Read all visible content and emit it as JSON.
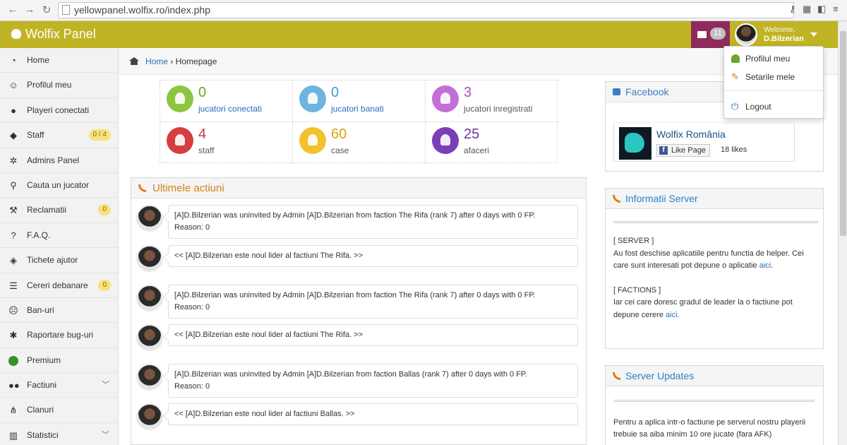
{
  "browser": {
    "url": "yellowpanel.wolfix.ro/index.php"
  },
  "header": {
    "brand": "Wolfix Panel",
    "messages_count": "11",
    "welcome": "Welcome,",
    "username": "D.Bilzerian"
  },
  "dropdown": {
    "items": [
      "Profilul meu",
      "Setarile mele",
      "Logout"
    ]
  },
  "sidebar": {
    "items": [
      {
        "label": "Home",
        "icon": "dashboard-icon"
      },
      {
        "label": "Profilul meu",
        "icon": "smile-icon"
      },
      {
        "label": "Playeri conectati",
        "icon": "user-icon"
      },
      {
        "label": "Staff",
        "icon": "android-icon",
        "badge": "0 / 4"
      },
      {
        "label": "Admins Panel",
        "icon": "gear-icon"
      },
      {
        "label": "Cauta un jucator",
        "icon": "search-icon"
      },
      {
        "label": "Reclamatii",
        "icon": "gavel-icon",
        "badge": "0"
      },
      {
        "label": "F.A.Q.",
        "icon": "question-icon"
      },
      {
        "label": "Tichete ajutor",
        "icon": "ticket-icon"
      },
      {
        "label": "Cereri debanare",
        "icon": "list-icon",
        "badge": "0"
      },
      {
        "label": "Ban-uri",
        "icon": "frown-icon"
      },
      {
        "label": "Raportare bug-uri",
        "icon": "bug-icon"
      },
      {
        "label": "Premium",
        "icon": "star-icon"
      },
      {
        "label": "Factiuni",
        "icon": "users-icon"
      },
      {
        "label": "Clanuri",
        "icon": "sitemap-icon"
      },
      {
        "label": "Statistici",
        "icon": "chart-icon"
      }
    ]
  },
  "breadcrumb": {
    "home": "Home",
    "current": "Homepage"
  },
  "stats": [
    {
      "value": "0",
      "label": "jucatori conectati",
      "color": "#8cc63e"
    },
    {
      "value": "0",
      "label": "jucatori banati",
      "color": "#6fb3e0"
    },
    {
      "value": "3",
      "label": "jucatori inregistrati",
      "color": "#c46fd6"
    },
    {
      "value": "4",
      "label": "staff",
      "color": "#d53f40"
    },
    {
      "value": "60",
      "label": "case",
      "color": "#f2c12e"
    },
    {
      "value": "25",
      "label": "afaceri",
      "color": "#7b3fb8"
    }
  ],
  "activity": {
    "title": "Ultimele actiuni",
    "entries": [
      {
        "line1": "[A]D.Bilzerian was uninvited by Admin [A]D.Bilzerian from faction The Rifa (rank 7) after 0 days with 0 FP.",
        "line2": "Reason: 0"
      },
      {
        "line1": "<< [A]D.Bilzerian este noul lider al factiuni The Rifa. >>",
        "line2": ""
      },
      {
        "line1": "[A]D.Bilzerian was uninvited by Admin [A]D.Bilzerian from faction The Rifa (rank 7) after 0 days with 0 FP.",
        "line2": "Reason: 0"
      },
      {
        "line1": "<< [A]D.Bilzerian este noul lider al factiuni The Rifa. >>",
        "line2": ""
      },
      {
        "line1": "[A]D.Bilzerian was uninvited by Admin [A]D.Bilzerian from faction Ballas (rank 7) after 0 days with 0 FP.",
        "line2": "Reason: 0"
      },
      {
        "line1": "<< [A]D.Bilzerian este noul lider al factiuni Ballas. >>",
        "line2": ""
      }
    ]
  },
  "facebook": {
    "title": "Facebook",
    "page_name": "Wolfix România",
    "like_label": "Like Page",
    "likes": "18 likes"
  },
  "server_info": {
    "title": "Informatii Server",
    "server_heading": "[ SERVER ]",
    "server_text": "Au fost deschise aplicatiile pentru functia de helper. Cei care sunt interesati pot depune o aplicatie",
    "link": "aici",
    "factions_heading": "[ FACTIONS ]",
    "factions_text": "Iar cei care doresc gradul de leader la o factiune pot depune cerere"
  },
  "server_updates": {
    "title": "Server Updates",
    "text": "Pentru a aplica intr-o factiune pe serverul nostru playerii trebuie sa aiba minim 10 ore jucate (fara AFK)"
  }
}
